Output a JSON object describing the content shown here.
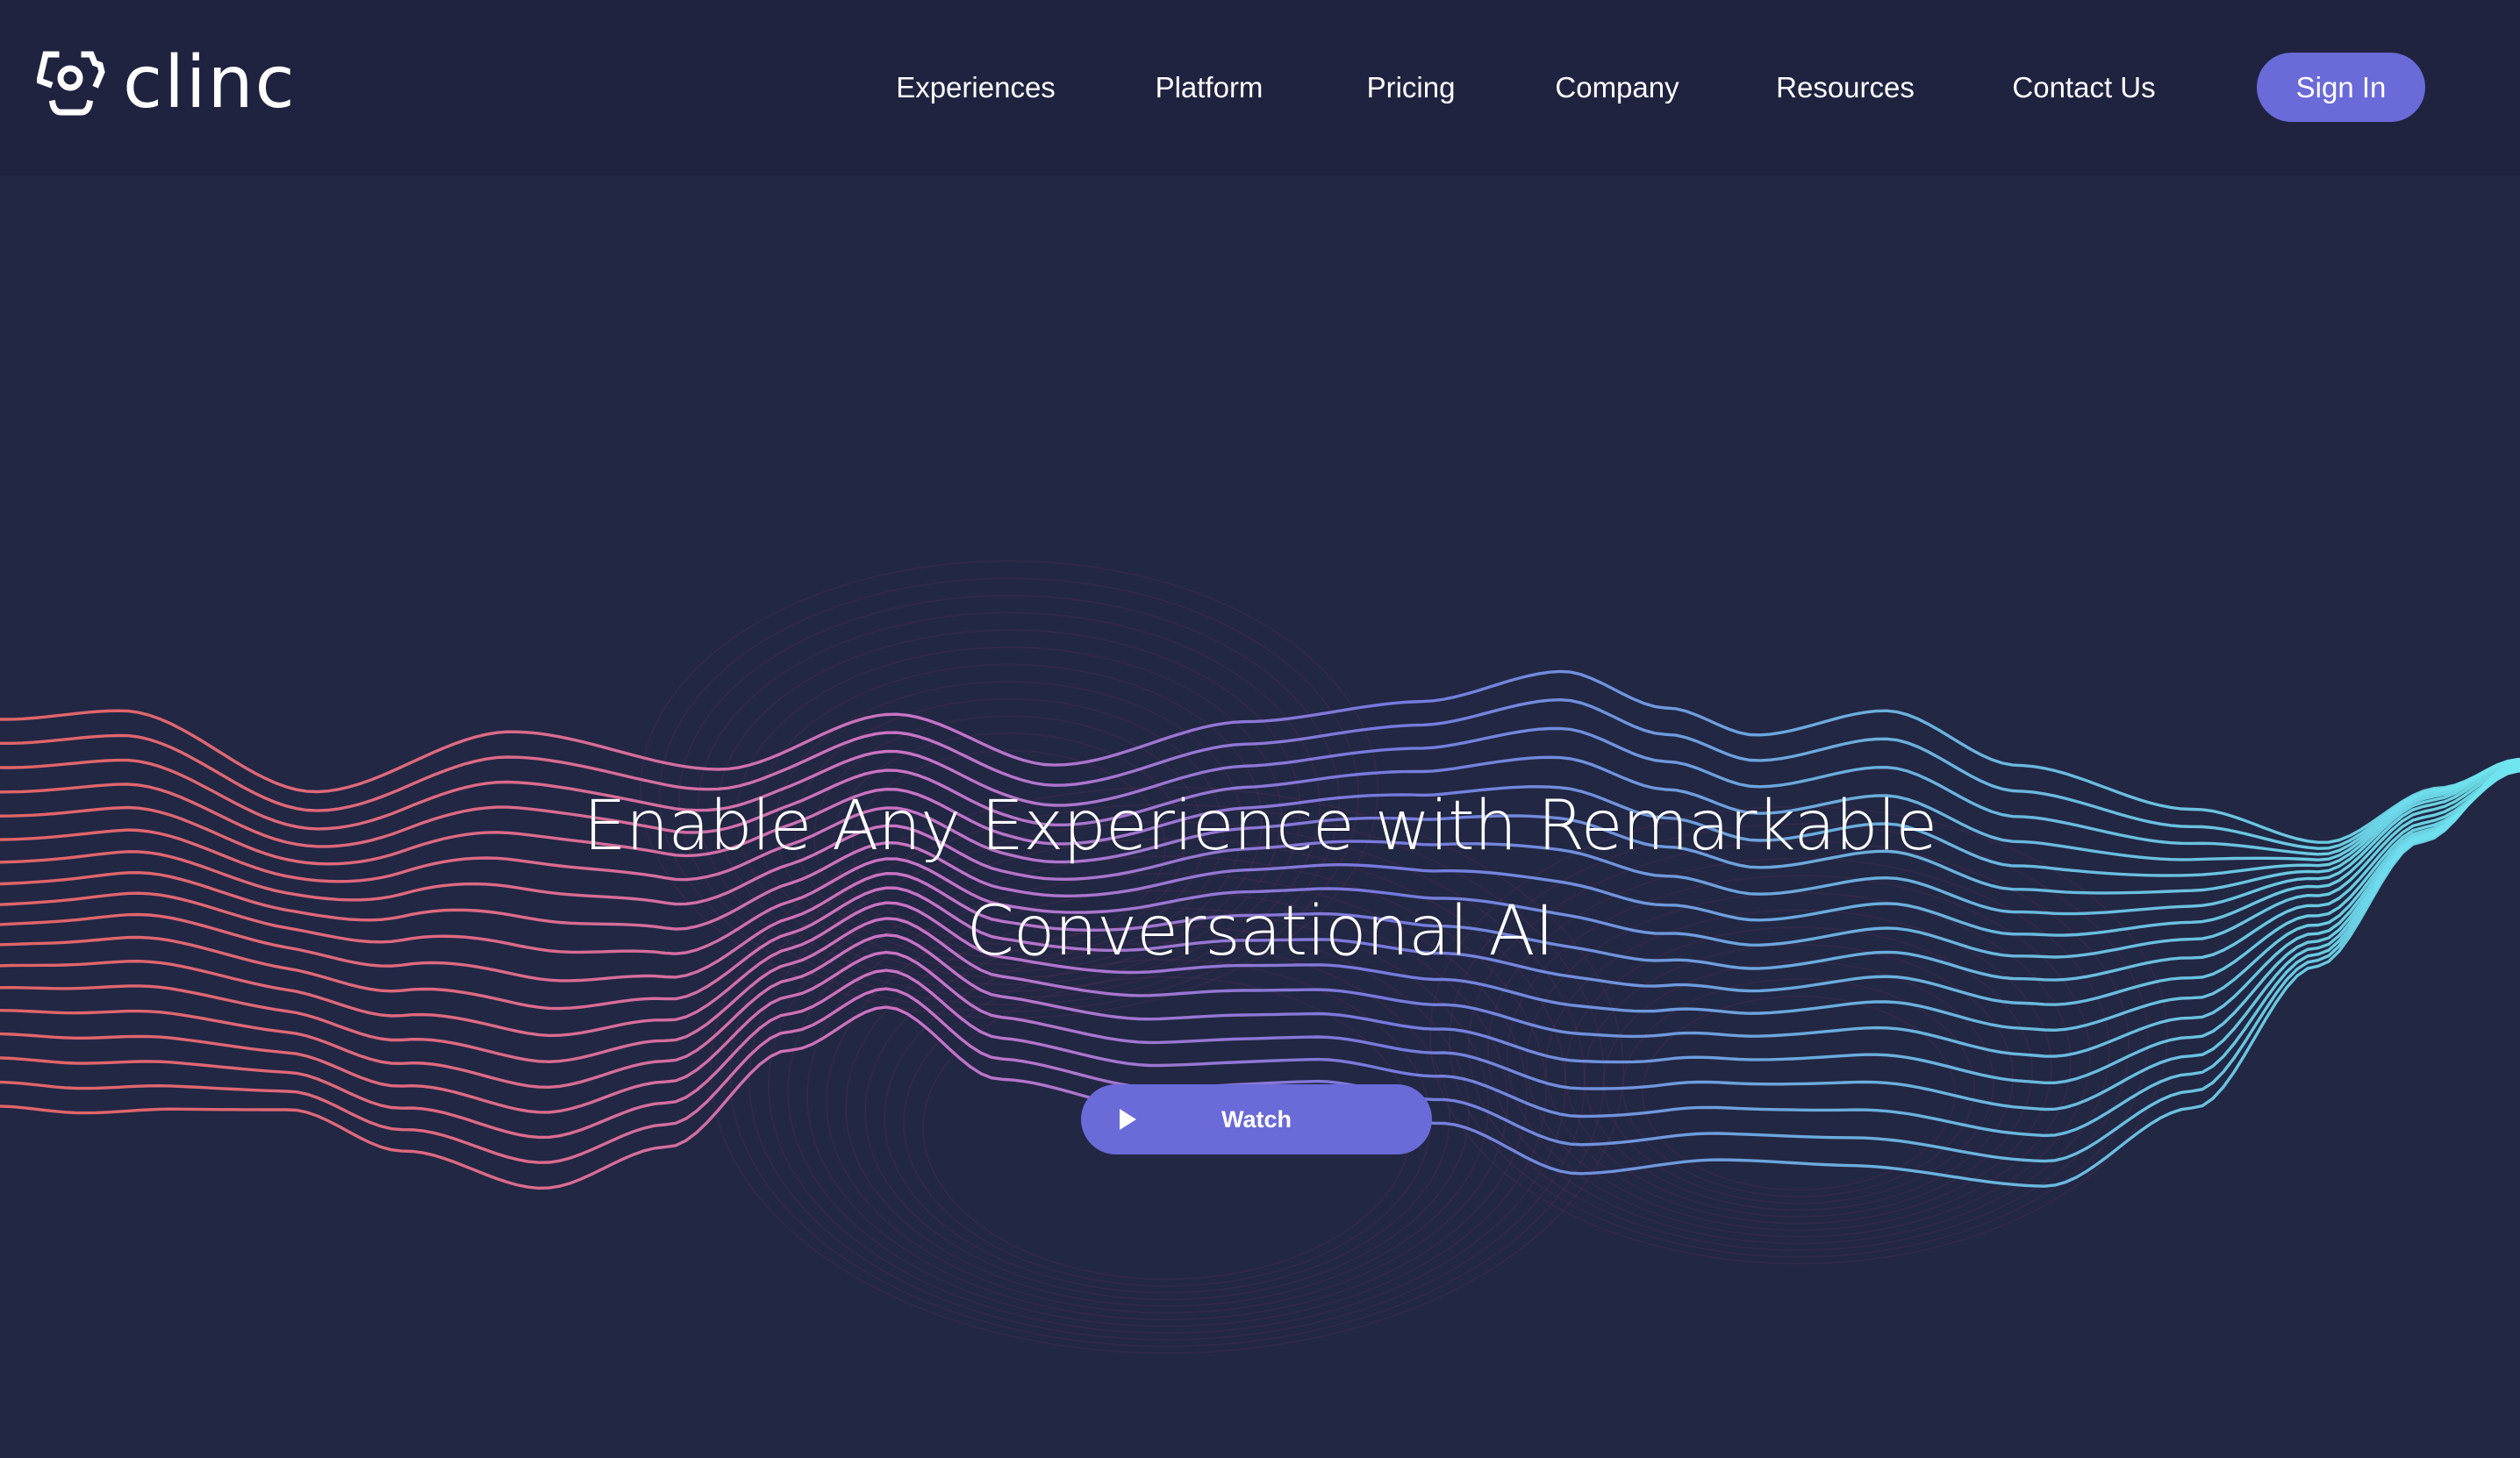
{
  "brand": {
    "name": "clinc",
    "logo_icon": "clinc-bracket-face-icon"
  },
  "nav": {
    "items": [
      {
        "label": "Experiences"
      },
      {
        "label": "Platform"
      },
      {
        "label": "Pricing"
      },
      {
        "label": "Company"
      },
      {
        "label": "Resources"
      },
      {
        "label": "Contact Us"
      }
    ],
    "sign_in_label": "Sign In"
  },
  "hero": {
    "headline_line1": "Enable Any Experience with Remarkable",
    "headline_line2": "Conversational AI",
    "watch_label": "Watch",
    "watch_icon": "play-icon",
    "background_graphic": "gradient-sound-wave-lines"
  },
  "colors": {
    "header_bg": "#1f2340",
    "hero_bg": "#222744",
    "accent": "#6a6ad8",
    "wave_left": "#f06a6a",
    "wave_mid": "#7a7ae8",
    "wave_right": "#6fe3ee",
    "text": "#ffffff"
  }
}
